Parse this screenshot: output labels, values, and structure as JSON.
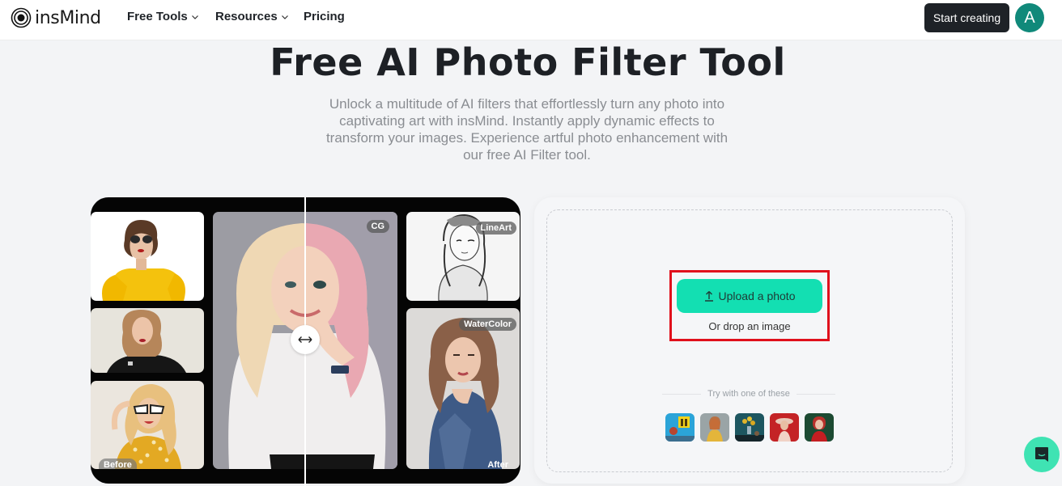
{
  "nav": {
    "brand": "insMind",
    "items": [
      {
        "label": "Free Tools",
        "has_dropdown": true
      },
      {
        "label": "Resources",
        "has_dropdown": true
      },
      {
        "label": "Pricing",
        "has_dropdown": false
      }
    ],
    "cta_label": "Start creating",
    "avatar_initial": "A"
  },
  "hero": {
    "title": "Free AI Photo Filter Tool",
    "subtitle": "Unlock a multitude of AI filters that effortlessly turn any photo into captivating art with insMind. Instantly apply dynamic effects to transform your images. Experience artful photo enhancement with our free AI Filter tool."
  },
  "collage": {
    "badges": {
      "cg": "CG",
      "lineart": "LineArt",
      "watercolor": "WaterColor"
    },
    "before_label": "Before",
    "after_label": "After",
    "handle_icon": "left-right-arrows-icon"
  },
  "upload": {
    "button_label": "Upload a photo",
    "button_icon": "upload-arrow-icon",
    "drop_text": "Or drop an image",
    "try_text": "Try with one of these",
    "samples": [
      {
        "name": "sample-blue-wall-window"
      },
      {
        "name": "sample-woman-yellow"
      },
      {
        "name": "sample-flowers-teal"
      },
      {
        "name": "sample-woman-red-hat"
      },
      {
        "name": "sample-woman-green"
      }
    ]
  },
  "colors": {
    "accent": "#13dfb2",
    "cta_dark": "#1e2227",
    "avatar": "#10897a",
    "highlight": "#e0101c",
    "chat": "#3fe3b3"
  },
  "chat": {
    "icon": "chat-icon"
  }
}
